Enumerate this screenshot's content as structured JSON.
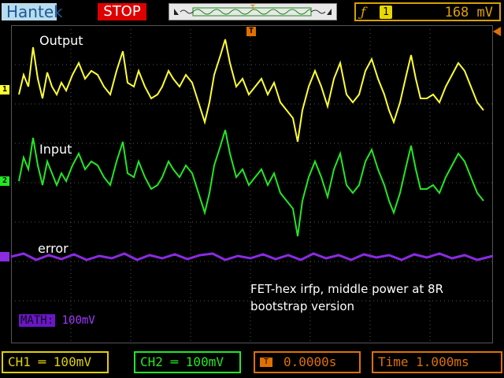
{
  "topbar": {
    "brand": "Hantek",
    "run_state": "STOP",
    "trigger": {
      "icon": "rising-edge-icon",
      "channel": "1",
      "level": "168  mV"
    }
  },
  "traces": {
    "labels": [
      "Output",
      "Input",
      "error"
    ],
    "colors": {
      "ch1": "#ffff33",
      "ch2": "#22e822",
      "math": "#8a2be2"
    }
  },
  "markers": {
    "ch1": "1",
    "ch2": "2",
    "trigger_pos": "T"
  },
  "note": [
    "FET-hex irfp, middle power at 8R",
    "bootstrap version"
  ],
  "math": {
    "tag": "MATH:",
    "scale": "100mV"
  },
  "bottombar": {
    "ch1": "CH1 ═ 100mV",
    "ch2": "CH2 ═ 100mV",
    "trig_offset": "0.0000s",
    "time": "Time 1.000ms"
  }
}
